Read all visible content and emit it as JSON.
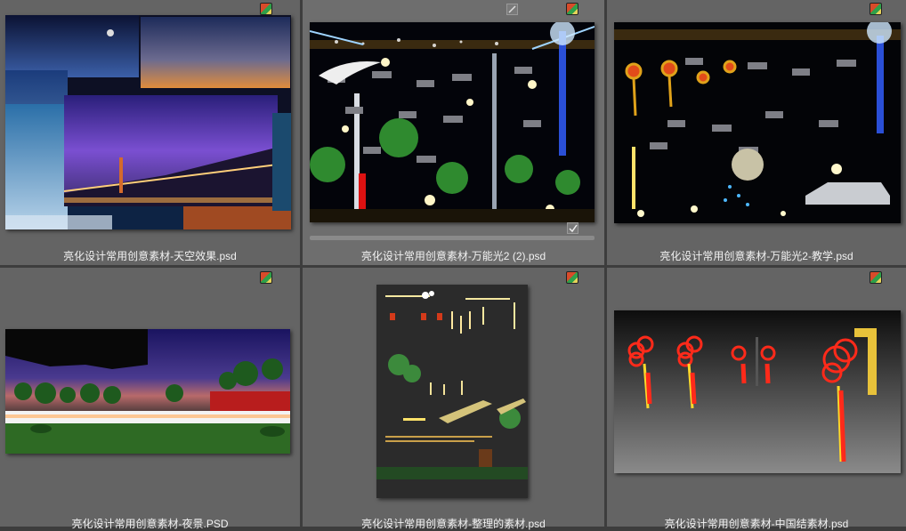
{
  "files": [
    {
      "name": "亮化设计常用创意素材-天空效果.psd",
      "thumb": "sky-effects-collage"
    },
    {
      "name": "亮化设计常用创意素材-万能光2 (2).psd",
      "thumb": "universal-light-2-night-plaza",
      "selected": true
    },
    {
      "name": "亮化设计常用创意素材-万能光2-教学.psd",
      "thumb": "universal-light-2-tutorial"
    },
    {
      "name": "亮化设计常用创意素材-夜景.PSD",
      "thumb": "night-scene-park"
    },
    {
      "name": "亮化设计常用创意素材-整理的素材.psd",
      "thumb": "organized-materials"
    },
    {
      "name": "亮化设计常用创意素材-中国结素材.psd",
      "thumb": "chinese-knot-materials"
    }
  ],
  "icons": {
    "file_badge": "photoshop-file-icon",
    "select_box": "checkbox-icon",
    "checkmark": "checkmark-icon"
  },
  "colors": {
    "background": "#3d3d3d",
    "cell": "#646464",
    "selected_cell": "#6e6e6e",
    "caption_text": "#f2f2f2"
  }
}
